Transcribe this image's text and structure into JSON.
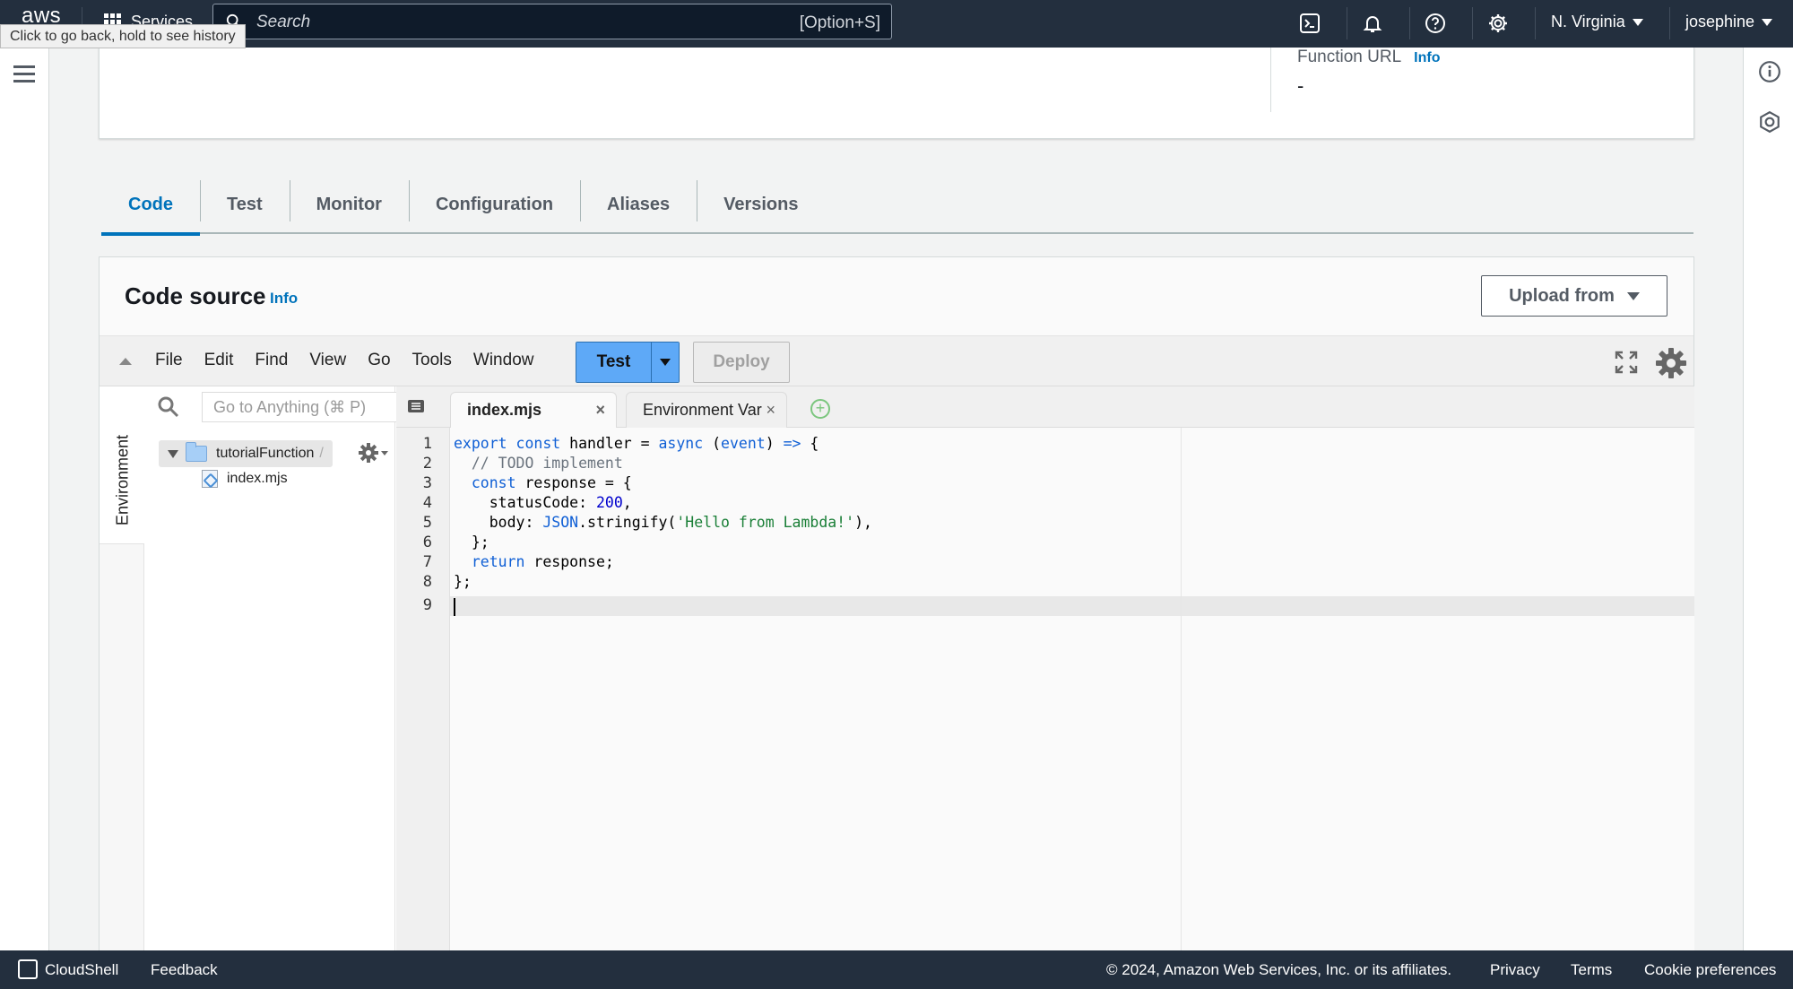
{
  "topnav": {
    "logo": "aws",
    "services_label": "Services",
    "search_placeholder": "Search",
    "search_shortcut": "[Option+S]",
    "region": "N. Virginia",
    "user": "josephine",
    "icons": [
      "cloudshell-icon",
      "bell-icon",
      "help-icon",
      "gear-icon"
    ]
  },
  "tooltip": "Click to go back, hold to see history",
  "overview": {
    "function_url_label": "Function URL",
    "info": "Info",
    "function_url_value": "-"
  },
  "tabs": [
    {
      "label": "Code",
      "active": true
    },
    {
      "label": "Test"
    },
    {
      "label": "Monitor"
    },
    {
      "label": "Configuration"
    },
    {
      "label": "Aliases"
    },
    {
      "label": "Versions"
    }
  ],
  "code_source": {
    "title": "Code source",
    "info": "Info",
    "upload_label": "Upload from"
  },
  "ide": {
    "menu": [
      "File",
      "Edit",
      "Find",
      "View",
      "Go",
      "Tools",
      "Window"
    ],
    "test_label": "Test",
    "deploy_label": "Deploy",
    "goto_placeholder": "Go to Anything (⌘ P)",
    "side_tab": "Environment",
    "tree": {
      "root": "tutorialFunction",
      "root_suffix": "/",
      "file": "index.mjs"
    },
    "editor_tabs": [
      {
        "label": "index.mjs",
        "close": "×"
      },
      {
        "label": "Environment Var",
        "close": "×"
      }
    ],
    "add_tab": "+",
    "line_numbers": [
      "1",
      "2",
      "3",
      "4",
      "5",
      "6",
      "7",
      "8",
      "9"
    ],
    "code": {
      "l1": {
        "a": "export",
        "b": " ",
        "c": "const",
        "d": " handler = ",
        "e": "async",
        "f": " (",
        "g": "event",
        "h": ") ",
        "i": "=>",
        "j": " {"
      },
      "l2": {
        "a": "  ",
        "b": "// TODO implement"
      },
      "l3": {
        "a": "  ",
        "b": "const",
        "c": " response = {"
      },
      "l4": {
        "a": "    statusCode: ",
        "b": "200",
        "c": ","
      },
      "l5": {
        "a": "    body: ",
        "b": "JSON",
        "c": ".stringify(",
        "d": "'Hello from Lambda!'",
        "e": "),"
      },
      "l6": {
        "a": "  };"
      },
      "l7": {
        "a": "  ",
        "b": "return",
        "c": " response;"
      },
      "l8": {
        "a": "};"
      }
    }
  },
  "footer": {
    "cloudshell": "CloudShell",
    "feedback": "Feedback",
    "copyright": "© 2024, Amazon Web Services, Inc. or its affiliates.",
    "privacy": "Privacy",
    "terms": "Terms",
    "cookies": "Cookie preferences"
  },
  "colors": {
    "nav_bg": "#232f3e",
    "accent": "#0073bb",
    "test_button": "#5ea9f7",
    "aws_orange": "#ff9900"
  }
}
